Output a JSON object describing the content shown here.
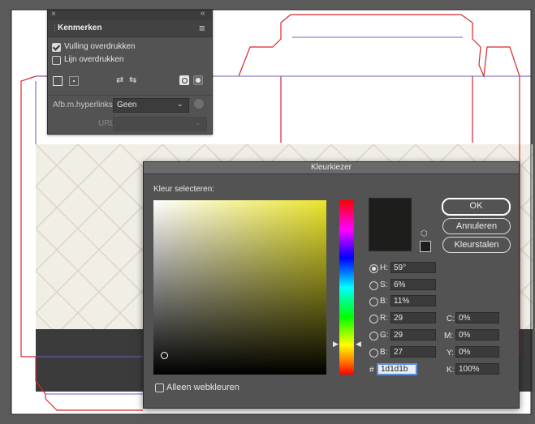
{
  "panel": {
    "tab_title": "Kenmerken",
    "close_glyph": "×",
    "collapse_glyph": "«",
    "menu_glyph": "≡",
    "overprint_fill_label": "Vulling overdrukken",
    "overprint_fill_checked": true,
    "overprint_stroke_label": "Lijn overdrukken",
    "overprint_stroke_checked": false,
    "hyperlink_label": "Afb.m.hyperlinks:",
    "hyperlink_value": "Geen",
    "url_label": "URL:",
    "url_value": ""
  },
  "dialog": {
    "title": "Kleurkiezer",
    "select_label": "Kleur selecteren:",
    "ok_label": "OK",
    "cancel_label": "Annuleren",
    "swatches_label": "Kleurstalen",
    "web_colors_label": "Alleen webkleuren",
    "hex_prefix": "#",
    "hex_value": "1d1d1b",
    "current_color": "#1d1d1b",
    "fields": {
      "h": {
        "label": "H:",
        "value": "59°"
      },
      "s": {
        "label": "S:",
        "value": "6%"
      },
      "b": {
        "label": "B:",
        "value": "11%"
      },
      "r": {
        "label": "R:",
        "value": "29"
      },
      "g": {
        "label": "G:",
        "value": "29"
      },
      "bl": {
        "label": "B:",
        "value": "27"
      },
      "c": {
        "label": "C:",
        "value": "0%"
      },
      "m": {
        "label": "M:",
        "value": "0%"
      },
      "y": {
        "label": "Y:",
        "value": "0%"
      },
      "k": {
        "label": "K:",
        "value": "100%"
      }
    }
  },
  "colors": {
    "dieline_red": "#d9262c",
    "dieline_purple": "#6e63b8"
  }
}
